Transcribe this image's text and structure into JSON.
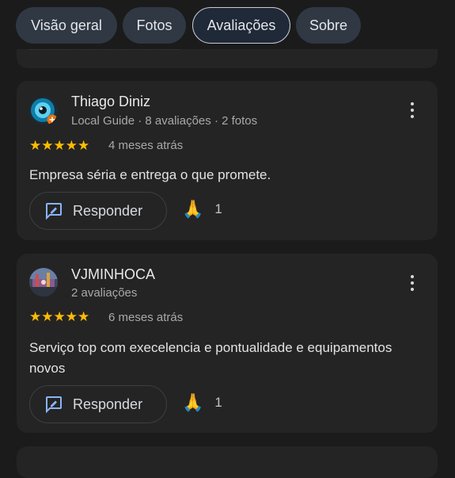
{
  "tabs": [
    {
      "label": "Visão geral",
      "active": false
    },
    {
      "label": "Fotos",
      "active": false
    },
    {
      "label": "Avaliações",
      "active": true
    },
    {
      "label": "Sobre",
      "active": false
    }
  ],
  "reviews": [
    {
      "name": "Thiago Diniz",
      "meta": "Local Guide · 8 avaliações · 2 fotos",
      "rating": 5,
      "stars": "★★★★★",
      "when": "4 meses atrás",
      "text": "Empresa séria e entrega o que promete.",
      "reply_label": "Responder",
      "reaction_emoji": "🙏",
      "reaction_count": "1"
    },
    {
      "name": "VJMINHOCA",
      "meta": "2 avaliações",
      "rating": 5,
      "stars": "★★★★★",
      "when": "6 meses atrás",
      "text": "Serviço top com execelencia e pontualidade e equipamentos novos",
      "reply_label": "Responder",
      "reaction_emoji": "🙏",
      "reaction_count": "1"
    }
  ],
  "colors": {
    "background": "#1b1b1b",
    "card": "#242424",
    "star": "#fbbc04",
    "tab_bg": "#303844",
    "reply_icon": "#8ab4f8"
  },
  "icons": {
    "kebab": "more-vert-icon",
    "reply": "reply-comment-icon",
    "local_guide_badge": "local-guide-badge-icon"
  }
}
